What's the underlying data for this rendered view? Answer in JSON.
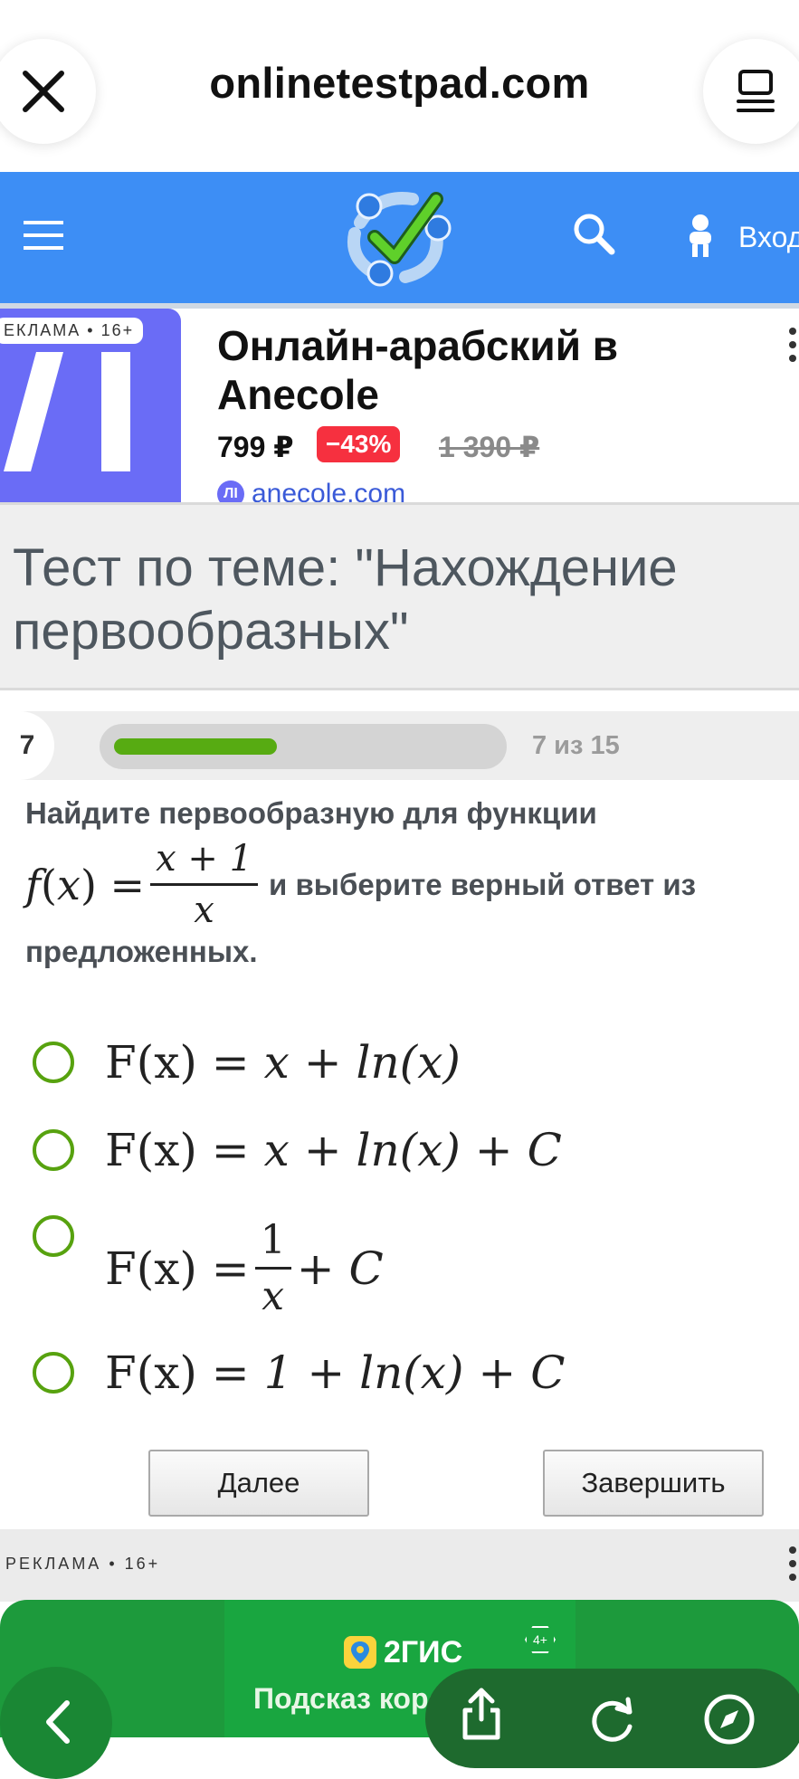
{
  "browser": {
    "url": "onlinetestpad.com",
    "close_icon": "close-icon",
    "tabs_icon": "reader-icon"
  },
  "site_header": {
    "menu_icon": "hamburger-icon",
    "logo_icon": "checkmark-logo",
    "search_icon": "search-icon",
    "login_icon": "user-keys-icon",
    "login_label": "Вход"
  },
  "ad_top": {
    "tag": "ЕКЛАМА • 16+",
    "title": "Онлайн-арабский в Anecole",
    "price": "799 ₽",
    "discount": "−43%",
    "old_price": "1 390 ₽",
    "domain": "anecole.com",
    "brand_color": "#6a6cf6"
  },
  "test": {
    "title": "Тест по теме: \"Нахождение первообразных\""
  },
  "progress": {
    "question_number": "7",
    "label": "7 из 15",
    "fraction": 0.43,
    "fill_color": "#57ab12"
  },
  "question": {
    "text_before": "Найдите первообразную для функции",
    "func_lhs": "f(x) =",
    "func_num": "x + 1",
    "func_den": "x",
    "text_after": "и выберите верный ответ из",
    "text_end": "предложенных."
  },
  "options": [
    {
      "lhs": "F(x) =",
      "rhs": "x + ln(x)"
    },
    {
      "lhs": "F(x) =",
      "rhs": "x + ln(x) + C"
    },
    {
      "lhs": "F(x) =",
      "num": "1",
      "den": "x",
      "tail": "+ C"
    },
    {
      "lhs": "F(x) =",
      "rhs": "1 + ln(x) + C"
    }
  ],
  "buttons": {
    "next": "Далее",
    "finish": "Завершить"
  },
  "ad_bottom": {
    "tag": "РЕКЛАМА • 16+",
    "brand": "2ГИС",
    "age": "4+",
    "text": "Подсказ короткий м"
  },
  "bottom_toolbar": {
    "back_icon": "chevron-left-icon",
    "share_icon": "share-icon",
    "reload_icon": "reload-icon",
    "compass_icon": "compass-icon"
  }
}
